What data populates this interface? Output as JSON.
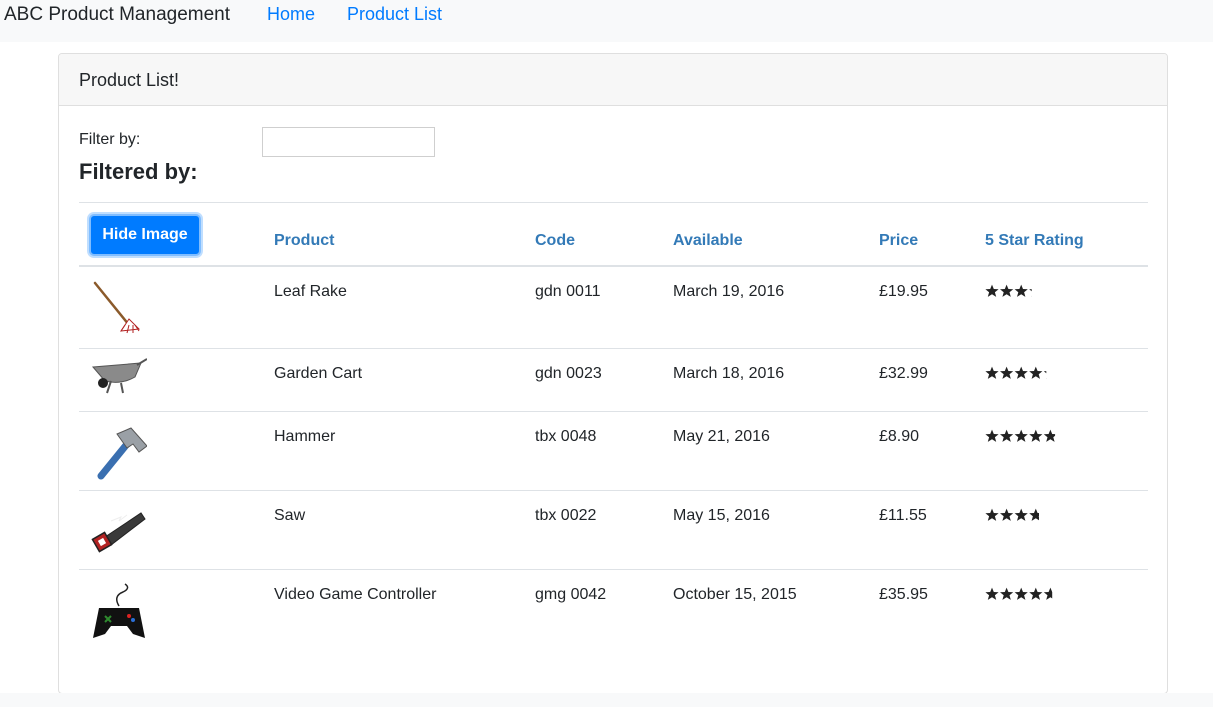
{
  "nav": {
    "brand": "ABC Product Management",
    "links": [
      "Home",
      "Product List"
    ]
  },
  "card": {
    "title": "Product List!",
    "filter_label": "Filter by:",
    "filter_value": "",
    "filtered_by": "Filtered by:",
    "hide_button": "Hide Image"
  },
  "table": {
    "headers": [
      "Product",
      "Code",
      "Available",
      "Price",
      "5 Star Rating"
    ],
    "rows": [
      {
        "name": "Leaf Rake",
        "code": "gdn 0011",
        "available": "March 19, 2016",
        "price": "£19.95",
        "rating": 3.2,
        "icon": "leaf-rake-icon"
      },
      {
        "name": "Garden Cart",
        "code": "gdn 0023",
        "available": "March 18, 2016",
        "price": "£32.99",
        "rating": 4.2,
        "icon": "garden-cart-icon"
      },
      {
        "name": "Hammer",
        "code": "tbx 0048",
        "available": "May 21, 2016",
        "price": "£8.90",
        "rating": 4.8,
        "icon": "hammer-icon"
      },
      {
        "name": "Saw",
        "code": "tbx 0022",
        "available": "May 15, 2016",
        "price": "£11.55",
        "rating": 3.7,
        "icon": "saw-icon"
      },
      {
        "name": "Video Game Controller",
        "code": "gmg 0042",
        "available": "October 15, 2015",
        "price": "£35.95",
        "rating": 4.6,
        "icon": "game-controller-icon"
      }
    ]
  },
  "colors": {
    "link": "#007bff",
    "header_link": "#337ab7",
    "button": "#007bff",
    "star": "#222222"
  }
}
